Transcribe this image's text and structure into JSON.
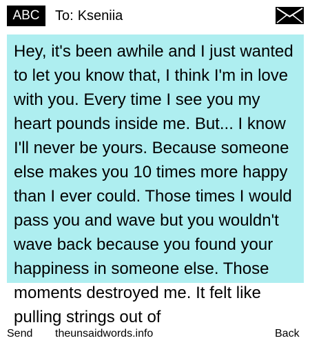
{
  "header": {
    "input_mode": "ABC",
    "to_label": "To:",
    "recipient": "Kseniia",
    "icon": "envelope-icon"
  },
  "message": {
    "body": "Hey, it's been awhile and I just wanted to let you know that, I think I'm in love with you. Every time I see you my heart pounds inside me. But... I know I'll never be yours. Because someone else makes you 10 times more happy than I ever could. Those times I would pass you and wave but you wouldn't wave back because you found your happiness in someone else. Those moments destroyed me. It felt like pulling strings out of"
  },
  "softkeys": {
    "left": "Send",
    "center": "theunsaidwords.info",
    "right": "Back"
  },
  "colors": {
    "compose_background": "#aeeef0",
    "header_badge": "#000000"
  }
}
